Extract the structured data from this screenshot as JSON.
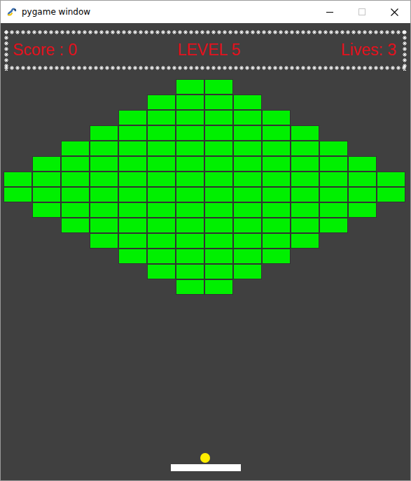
{
  "window": {
    "title": "pygame window",
    "maximize_disabled": true
  },
  "hud": {
    "score": "Score : 0",
    "level": "LEVEL 5",
    "lives": "Lives: 3"
  },
  "bricks": [
    [
      false,
      false,
      false,
      false,
      false,
      false,
      true,
      true,
      false,
      false,
      false,
      false,
      false,
      false
    ],
    [
      false,
      false,
      false,
      false,
      false,
      true,
      true,
      true,
      true,
      false,
      false,
      false,
      false,
      false
    ],
    [
      false,
      false,
      false,
      false,
      true,
      true,
      true,
      true,
      true,
      true,
      false,
      false,
      false,
      false
    ],
    [
      false,
      false,
      false,
      true,
      true,
      true,
      true,
      true,
      true,
      true,
      true,
      false,
      false,
      false
    ],
    [
      false,
      false,
      true,
      true,
      true,
      true,
      true,
      true,
      true,
      true,
      true,
      true,
      false,
      false
    ],
    [
      false,
      true,
      true,
      true,
      true,
      true,
      true,
      true,
      true,
      true,
      true,
      true,
      true,
      false
    ],
    [
      true,
      true,
      true,
      true,
      true,
      true,
      true,
      true,
      true,
      true,
      true,
      true,
      true,
      true
    ],
    [
      true,
      true,
      true,
      true,
      true,
      true,
      true,
      true,
      true,
      true,
      true,
      true,
      true,
      true
    ],
    [
      false,
      true,
      true,
      true,
      true,
      true,
      true,
      true,
      true,
      true,
      true,
      true,
      true,
      false
    ],
    [
      false,
      false,
      true,
      true,
      true,
      true,
      true,
      true,
      true,
      true,
      true,
      true,
      false,
      false
    ],
    [
      false,
      false,
      false,
      true,
      true,
      true,
      true,
      true,
      true,
      true,
      true,
      false,
      false,
      false
    ],
    [
      false,
      false,
      false,
      false,
      true,
      true,
      true,
      true,
      true,
      true,
      false,
      false,
      false,
      false
    ],
    [
      false,
      false,
      false,
      false,
      false,
      true,
      true,
      true,
      true,
      false,
      false,
      false,
      false,
      false
    ],
    [
      false,
      false,
      false,
      false,
      false,
      false,
      true,
      true,
      false,
      false,
      false,
      false,
      false,
      false
    ]
  ]
}
